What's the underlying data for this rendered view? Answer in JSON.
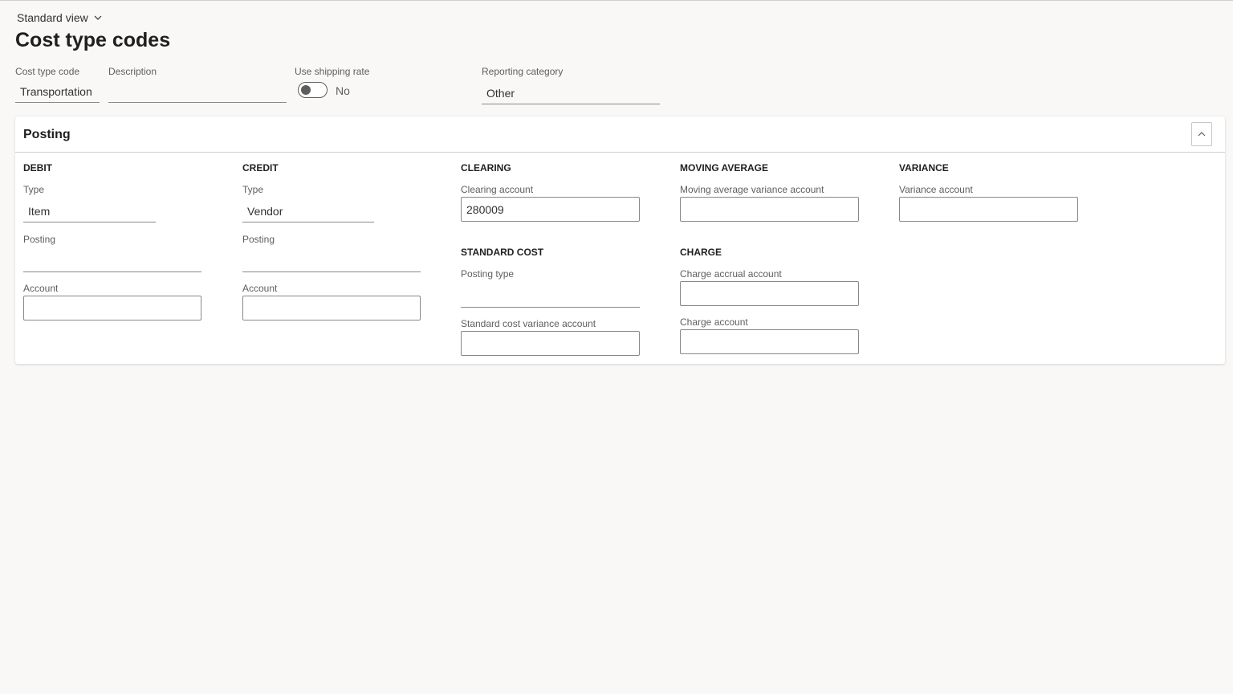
{
  "header": {
    "view_label": "Standard view",
    "title": "Cost type codes"
  },
  "form": {
    "cost_type_code": {
      "label": "Cost type code",
      "value": "Transportation"
    },
    "description": {
      "label": "Description",
      "value": ""
    },
    "use_shipping_rate": {
      "label": "Use shipping rate",
      "value": "No"
    },
    "reporting_category": {
      "label": "Reporting category",
      "value": "Other"
    }
  },
  "posting": {
    "title": "Posting",
    "debit": {
      "heading": "DEBIT",
      "type_label": "Type",
      "type_value": "Item",
      "posting_label": "Posting",
      "posting_value": "",
      "account_label": "Account",
      "account_value": ""
    },
    "credit": {
      "heading": "CREDIT",
      "type_label": "Type",
      "type_value": "Vendor",
      "posting_label": "Posting",
      "posting_value": "",
      "account_label": "Account",
      "account_value": ""
    },
    "clearing": {
      "heading": "CLEARING",
      "account_label": "Clearing account",
      "account_value": "280009"
    },
    "standard_cost": {
      "heading": "STANDARD COST",
      "posting_type_label": "Posting type",
      "posting_type_value": "",
      "variance_label": "Standard cost variance account",
      "variance_value": ""
    },
    "moving_average": {
      "heading": "MOVING AVERAGE",
      "account_label": "Moving average variance account",
      "account_value": ""
    },
    "charge": {
      "heading": "CHARGE",
      "accrual_label": "Charge accrual account",
      "accrual_value": "",
      "account_label": "Charge account",
      "account_value": ""
    },
    "variance": {
      "heading": "VARIANCE",
      "account_label": "Variance account",
      "account_value": ""
    }
  },
  "icons": {
    "view_dropdown": "chevron-down-icon",
    "collapse": "chevron-up-icon"
  },
  "colors": {
    "background": "#f9f8f7",
    "panel": "#ffffff",
    "border": "#8a8886",
    "text": "#323130"
  }
}
